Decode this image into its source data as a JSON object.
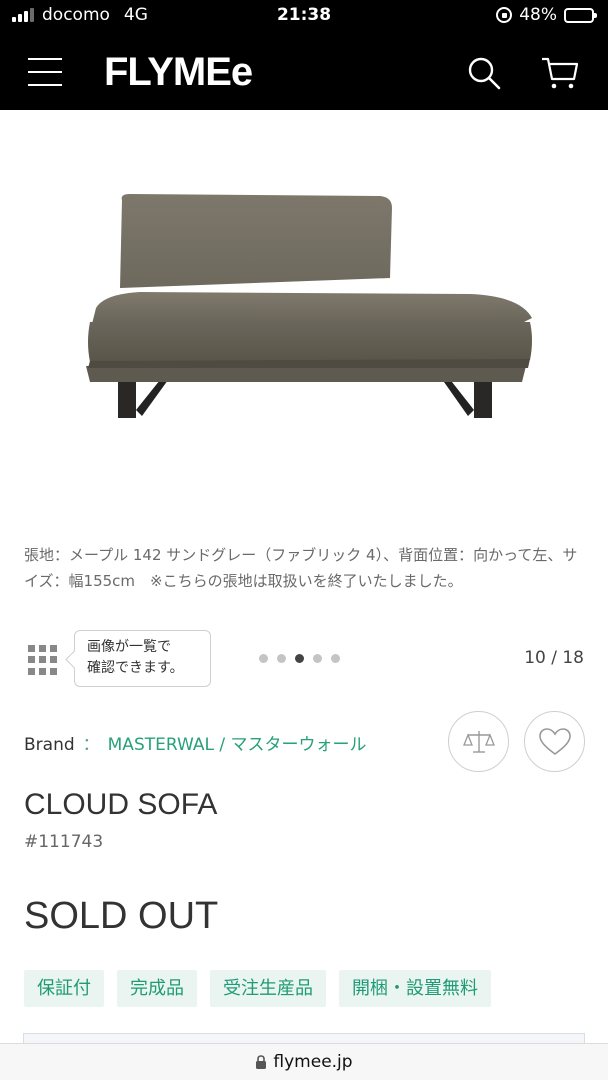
{
  "status_bar": {
    "carrier": "docomo",
    "network": "4G",
    "time": "21:38",
    "battery": "48%"
  },
  "header": {
    "logo": "FLYMEe",
    "menu_icon": "hamburger-menu-icon",
    "search_icon": "search-icon",
    "cart_icon": "cart-icon"
  },
  "product_image": {
    "subject": "sofa"
  },
  "caption": "張地：メープル 142 サンドグレー（ファブリック 4）、背面位置：向かって左、サイズ：幅155cm　※こちらの張地は取扱いを終了いたしました。",
  "gallery": {
    "tooltip_line1": "画像が一覧で",
    "tooltip_line2": "確認できます。",
    "counter": "10 / 18",
    "dots": 5,
    "active_dot": 3
  },
  "brand": {
    "label": "Brand",
    "separator": "：",
    "name": "MASTERWAL / マスターウォール"
  },
  "actions": {
    "compare_icon": "balance-scale-icon",
    "favorite_icon": "heart-icon"
  },
  "product": {
    "name": "CLOUD SOFA",
    "code": "#111743",
    "status": "SOLD OUT"
  },
  "tags": [
    "保証付",
    "完成品",
    "受注生産品",
    "開梱・設置無料"
  ],
  "url_bar": {
    "domain": "flymee.jp"
  },
  "colors": {
    "header_bg": "#000000",
    "accent_green": "#27a17a",
    "tag_bg": "#eaf5f1"
  }
}
